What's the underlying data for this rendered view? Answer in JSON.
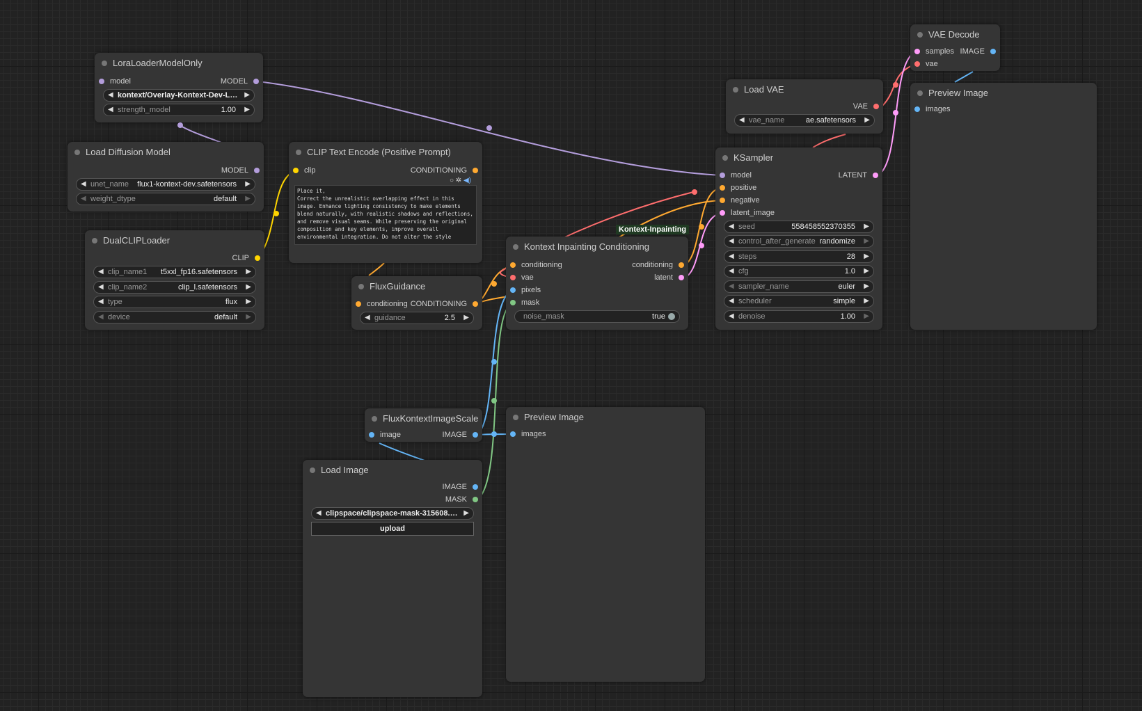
{
  "colors": {
    "model": "#b39ddb",
    "clip": "#ffd500",
    "conditioning": "#ffa931",
    "vae": "#ff6e6e",
    "latent": "#ff9cf9",
    "image": "#64b5f6",
    "mask": "#81c784",
    "canvas": "#222222",
    "node_bg": "#353535"
  },
  "group_label": "Kontext-Inpainting",
  "nodes": {
    "lora": {
      "title": "LoraLoaderModelOnly",
      "inputs": [
        "model"
      ],
      "outputs": [
        "MODEL"
      ],
      "widgets": [
        {
          "name": "",
          "value": "kontext/Overlay-Kontext-Dev-Lo ..."
        },
        {
          "name": "strength_model",
          "value": "1.00"
        }
      ]
    },
    "diffusion": {
      "title": "Load Diffusion Model",
      "outputs": [
        "MODEL"
      ],
      "widgets": [
        {
          "name": "unet_name",
          "value": "flux1-kontext-dev.safetensors"
        },
        {
          "name": "weight_dtype",
          "value": "default"
        }
      ]
    },
    "dualclip": {
      "title": "DualCLIPLoader",
      "outputs": [
        "CLIP"
      ],
      "widgets": [
        {
          "name": "clip_name1",
          "value": "t5xxl_fp16.safetensors"
        },
        {
          "name": "clip_name2",
          "value": "clip_l.safetensors"
        },
        {
          "name": "type",
          "value": "flux"
        },
        {
          "name": "device",
          "value": "default"
        }
      ]
    },
    "cliptext": {
      "title": "CLIP Text Encode (Positive Prompt)",
      "inputs": [
        "clip"
      ],
      "outputs": [
        "CONDITIONING"
      ],
      "text": "Place it,\nCorrect the unrealistic overlapping effect in this\nimage. Enhance lighting consistency to make elements\nblend naturally, with realistic shadows and reflections,\nand remove visual seams. While preserving the original\ncomposition and key elements, improve overall\nenvironmental integration. Do not alter the style"
    },
    "fluxguidance": {
      "title": "FluxGuidance",
      "inputs": [
        "conditioning"
      ],
      "outputs": [
        "CONDITIONING"
      ],
      "widgets": [
        {
          "name": "guidance",
          "value": "2.5"
        }
      ]
    },
    "kontextinpaint": {
      "title": "Kontext Inpainting Conditioning",
      "inputs": [
        "conditioning",
        "vae",
        "pixels",
        "mask"
      ],
      "outputs": [
        "conditioning",
        "latent"
      ],
      "widgets": [
        {
          "name": "noise_mask",
          "value": "true"
        }
      ]
    },
    "loadvae": {
      "title": "Load VAE",
      "outputs": [
        "VAE"
      ],
      "widgets": [
        {
          "name": "vae_name",
          "value": "ae.safetensors"
        }
      ]
    },
    "ksampler": {
      "title": "KSampler",
      "inputs": [
        "model",
        "positive",
        "negative",
        "latent_image"
      ],
      "outputs": [
        "LATENT"
      ],
      "widgets": [
        {
          "name": "seed",
          "value": "558458552370355"
        },
        {
          "name": "control_after_generate",
          "value": "randomize"
        },
        {
          "name": "steps",
          "value": "28"
        },
        {
          "name": "cfg",
          "value": "1.0"
        },
        {
          "name": "sampler_name",
          "value": "euler"
        },
        {
          "name": "scheduler",
          "value": "simple"
        },
        {
          "name": "denoise",
          "value": "1.00"
        }
      ]
    },
    "vaedecode": {
      "title": "VAE Decode",
      "inputs": [
        "samples",
        "vae"
      ],
      "outputs": [
        "IMAGE"
      ]
    },
    "preview_top": {
      "title": "Preview Image",
      "inputs": [
        "images"
      ]
    },
    "imagescale": {
      "title": "FluxKontextImageScale",
      "inputs": [
        "image"
      ],
      "outputs": [
        "IMAGE"
      ]
    },
    "preview_mid": {
      "title": "Preview Image",
      "inputs": [
        "images"
      ]
    },
    "loadimage": {
      "title": "Load Image",
      "outputs": [
        "IMAGE",
        "MASK"
      ],
      "widgets": [
        {
          "name": "",
          "value": "clipspace/clipspace-mask-315608.7 ..."
        }
      ],
      "upload_label": "upload"
    }
  }
}
